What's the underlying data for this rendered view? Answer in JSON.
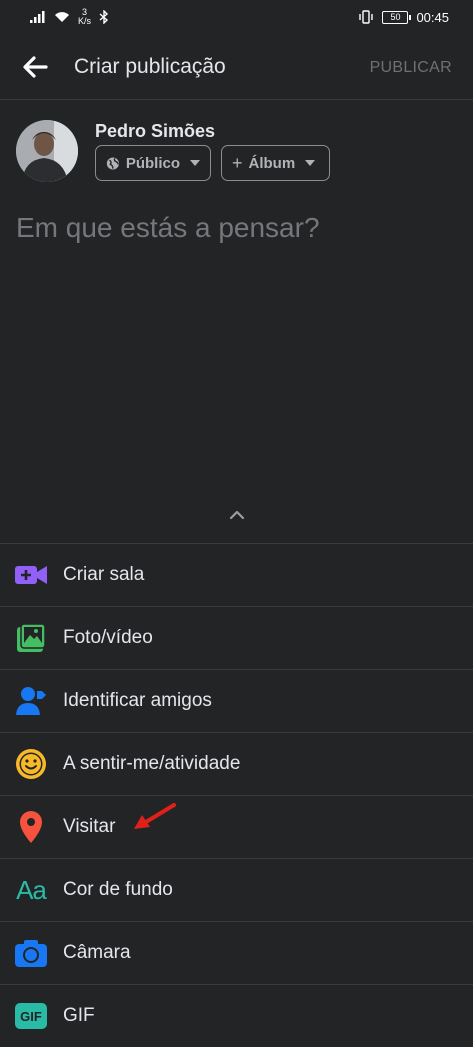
{
  "status_bar": {
    "net_speed_value": "3",
    "net_speed_unit": "K/s",
    "battery": "50",
    "time": "00:45"
  },
  "header": {
    "title": "Criar publicação",
    "publish": "PUBLICAR"
  },
  "post": {
    "user_name": "Pedro Simões",
    "audience": "Público",
    "album": "Álbum",
    "placeholder": "Em que estás a pensar?"
  },
  "menu": [
    {
      "label": "Criar sala",
      "icon": "video-room-icon",
      "color": "#9360f7"
    },
    {
      "label": "Foto/vídeo",
      "icon": "photo-icon",
      "color": "#45bd62"
    },
    {
      "label": "Identificar amigos",
      "icon": "tag-friends-icon",
      "color": "#1877f2"
    },
    {
      "label": "A sentir-me/atividade",
      "icon": "smiley-icon",
      "color": "#f7b928"
    },
    {
      "label": "Visitar",
      "icon": "location-pin-icon",
      "color": "#f5533d"
    },
    {
      "label": "Cor de fundo",
      "icon": "text-aa-icon",
      "color": "#2abba7"
    },
    {
      "label": "Câmara",
      "icon": "camera-icon",
      "color": "#1877f2"
    },
    {
      "label": "GIF",
      "icon": "gif-icon",
      "color": "#2abba7"
    }
  ],
  "annotation_color": "#e0201b"
}
